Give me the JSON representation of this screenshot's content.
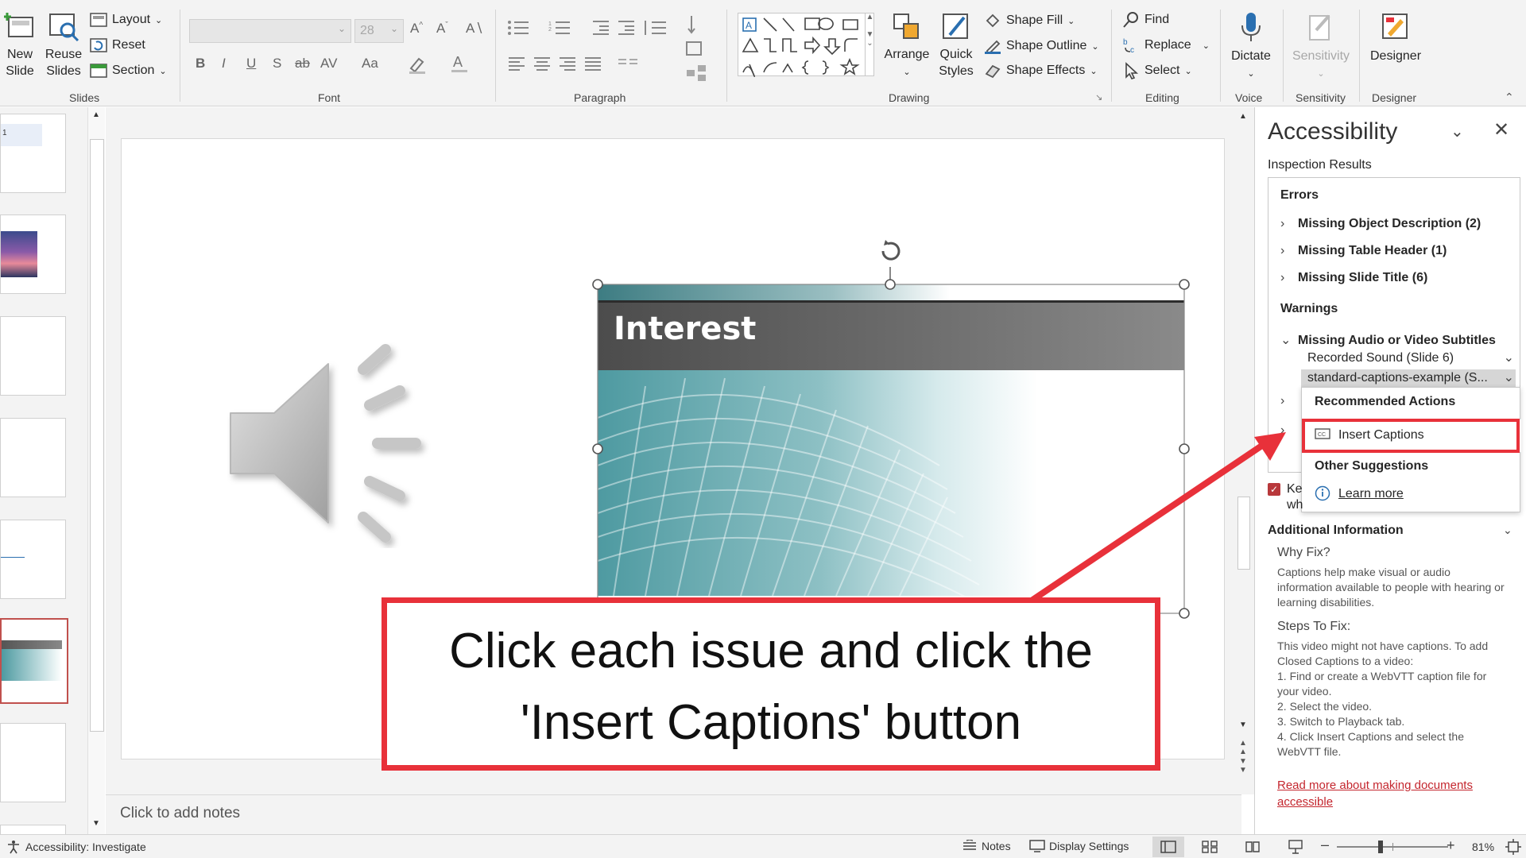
{
  "ribbon": {
    "slides": {
      "new_slide": "New\nSlide",
      "reuse_slides": "Reuse\nSlides",
      "layout": "Layout",
      "reset": "Reset",
      "section": "Section",
      "label": "Slides"
    },
    "font": {
      "size": "28",
      "label": "Font"
    },
    "paragraph": {
      "label": "Paragraph"
    },
    "drawing": {
      "arrange": "Arrange",
      "quick_styles": "Quick\nStyles",
      "shape_fill": "Shape Fill",
      "shape_outline": "Shape Outline",
      "shape_effects": "Shape Effects",
      "label": "Drawing"
    },
    "editing": {
      "find": "Find",
      "replace": "Replace",
      "select": "Select",
      "label": "Editing"
    },
    "voice": {
      "dictate": "Dictate",
      "label": "Voice"
    },
    "sensitivity": {
      "button": "Sensitivity",
      "label": "Sensitivity"
    },
    "designer": {
      "button": "Designer",
      "label": "Designer"
    }
  },
  "thumbnails": {
    "first_number": "1"
  },
  "slide": {
    "title": "Interest"
  },
  "notes": {
    "placeholder": "Click to add notes"
  },
  "accessibility_pane": {
    "title": "Accessibility",
    "inspection_results": "Inspection Results",
    "errors_heading": "Errors",
    "errors": [
      "Missing Object Description (2)",
      "Missing Table Header (1)",
      "Missing Slide Title (6)"
    ],
    "warnings_heading": "Warnings",
    "warning": "Missing Audio or Video Subtitles",
    "warning_items": [
      "Recorded Sound  (Slide 6)",
      "standard-captions-example  (S..."
    ],
    "recommended_actions": "Recommended Actions",
    "insert_captions": "Insert Captions",
    "other_suggestions": "Other Suggestions",
    "learn_more": "Learn more",
    "keep_checkbox_partial": [
      "Ke",
      "wh"
    ],
    "additional_information": "Additional Information",
    "why_fix_heading": "Why Fix?",
    "why_fix_text": "Captions help make visual or audio information available to people with hearing or learning disabilities.",
    "steps_heading": "Steps To Fix:",
    "steps_text": "This video might not have captions. To add Closed Captions to a video:\n1. Find or create a WebVTT caption file for your video.\n2. Select the video.\n3. Switch to Playback tab.\n4. Click Insert Captions and select the WebVTT file.",
    "read_more_link": "Read more about making documents accessible"
  },
  "status_bar": {
    "accessibility": "Accessibility: Investigate",
    "notes": "Notes",
    "display_settings": "Display Settings",
    "zoom": "81%"
  },
  "callout": {
    "text": "Click each issue and click the 'Insert Captions' button"
  },
  "colors": {
    "accent_red": "#e8313a",
    "ribbon_bg": "#f3f3f3",
    "link_red": "#c4262e",
    "slide_teal": "#4e9aa1"
  }
}
